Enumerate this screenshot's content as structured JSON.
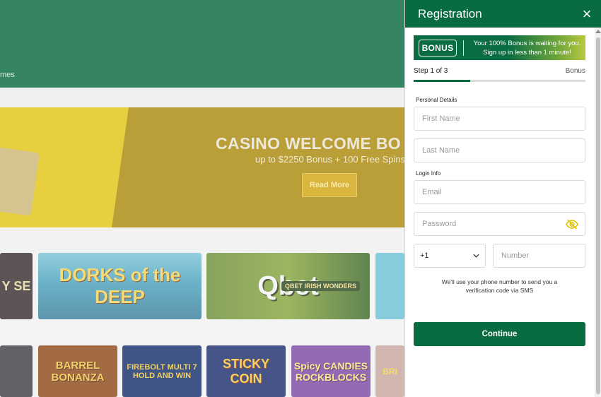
{
  "background": {
    "nav_fragment": "mes",
    "banner": {
      "title": "CASINO WELCOME BO",
      "subtitle": "up to $2250 Bonus + 100 Free Spins",
      "button": "Read More"
    },
    "games_row1": [
      {
        "title": "Y SE"
      },
      {
        "title": "DORKS of the DEEP"
      },
      {
        "title": "Qbet",
        "subtitle": "QBET IRISH WONDERS"
      },
      {
        "title": ""
      }
    ],
    "games_row2": [
      {
        "title": ""
      },
      {
        "title": "BARREL BONANZA"
      },
      {
        "title": "FIREBOLT MULTI 7 HOLD AND WIN"
      },
      {
        "title": "STICKY COIN"
      },
      {
        "title": "Spicy CANDIES ROCKBLOCKS"
      },
      {
        "title": "BRI"
      }
    ]
  },
  "registration": {
    "title": "Registration",
    "close": "×",
    "bonus": {
      "logo": "BONUS",
      "line1": "Your 100% Bonus is waiting for you.",
      "line2": "Sign up in less than 1 minute!"
    },
    "step_label": "Step 1 of 3",
    "step_next": "Bonus",
    "progress": 0.33,
    "personal_label": "Personal Details",
    "first_name_placeholder": "First Name",
    "last_name_placeholder": "Last Name",
    "login_label": "Login Info",
    "email_placeholder": "Email",
    "password_placeholder": "Password",
    "country_code": "+1",
    "number_placeholder": "Number",
    "sms_note": "We'll use your phone number to send you a verification code via SMS",
    "continue": "Continue"
  },
  "colors": {
    "brand_green": "#096b40",
    "banner_gold": "#ab8a0d",
    "eye_icon": "#e0c200"
  }
}
